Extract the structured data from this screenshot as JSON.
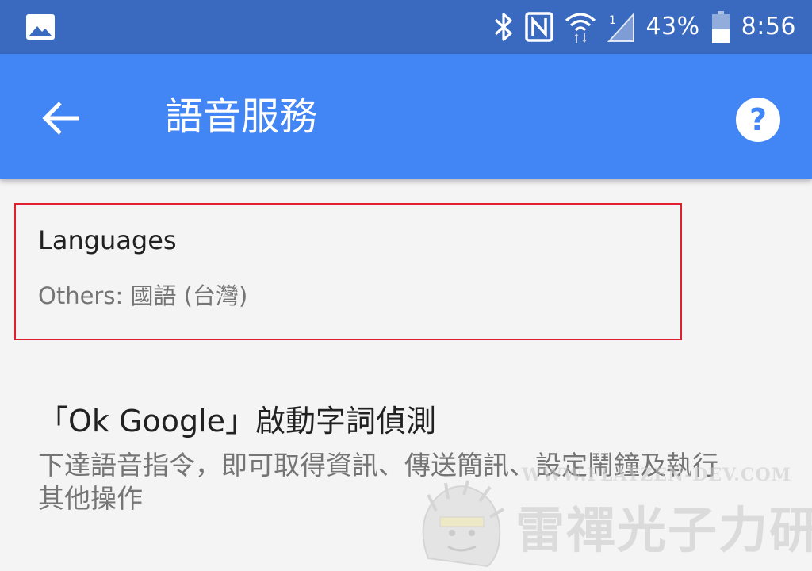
{
  "status_bar": {
    "battery_percent": "43%",
    "time": "8:56",
    "icons": [
      "photo-icon",
      "bluetooth-icon",
      "nfc-icon",
      "wifi-icon",
      "signal-icon",
      "battery-icon"
    ]
  },
  "app_bar": {
    "title": "語音服務",
    "back_icon": "arrow-back-icon",
    "help_icon": "help-circle-icon",
    "color": "#4285f4"
  },
  "settings": {
    "languages": {
      "title": "Languages",
      "summary": "Others: 國語 (台灣)"
    },
    "hotword": {
      "title": "「Ok Google」啟動字詞偵測",
      "summary": "下達語音指令，即可取得資訊、傳送簡訊、設定鬧鐘及執行其他操作"
    }
  },
  "highlight_color": "#e0202e",
  "watermark": {
    "url": "WWW.FLAYZEN-DEV.COM",
    "brand": "雷禪光子力研究所"
  }
}
